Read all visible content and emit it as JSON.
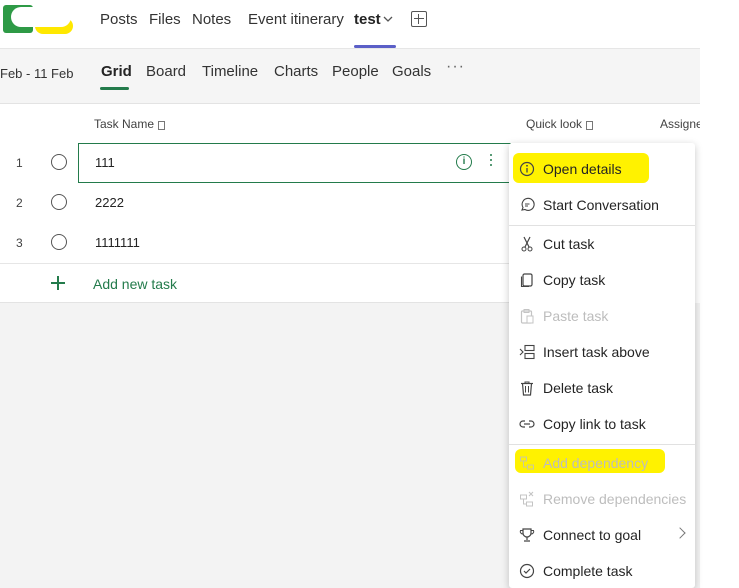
{
  "top_tabs": {
    "items": [
      "Posts",
      "Files",
      "Notes",
      "Event itinerary",
      "test"
    ],
    "active": "test"
  },
  "view": {
    "date_range": "Feb - 11 Feb",
    "tabs": [
      "Grid",
      "Board",
      "Timeline",
      "Charts",
      "People",
      "Goals"
    ],
    "active": "Grid",
    "more": "···"
  },
  "grid": {
    "headers": {
      "task_name": "Task Name",
      "quick_look": "Quick look",
      "assigned": "Assigne"
    },
    "rows": [
      {
        "num": "1",
        "name": "111"
      },
      {
        "num": "2",
        "name": "2222"
      },
      {
        "num": "3",
        "name": "1111111"
      }
    ],
    "add_task": "Add new task"
  },
  "context_menu": {
    "items": [
      {
        "label": "Open details",
        "icon": "info-icon",
        "enabled": true,
        "highlighted": true
      },
      {
        "label": "Start Conversation",
        "icon": "chat-icon",
        "enabled": true
      },
      {
        "label": "Cut task",
        "icon": "scissors-icon",
        "enabled": true
      },
      {
        "label": "Copy task",
        "icon": "copy-icon",
        "enabled": true
      },
      {
        "label": "Paste task",
        "icon": "clipboard-icon",
        "enabled": false
      },
      {
        "label": "Insert task above",
        "icon": "insert-above-icon",
        "enabled": true
      },
      {
        "label": "Delete task",
        "icon": "trash-icon",
        "enabled": true
      },
      {
        "label": "Copy link to task",
        "icon": "link-icon",
        "enabled": true
      },
      {
        "label": "Add dependency",
        "icon": "dependency-icon",
        "enabled": false,
        "highlighted": true
      },
      {
        "label": "Remove dependencies",
        "icon": "remove-dependency-icon",
        "enabled": false
      },
      {
        "label": "Connect to goal",
        "icon": "trophy-icon",
        "enabled": true,
        "submenu": true
      },
      {
        "label": "Complete task",
        "icon": "check-circle-icon",
        "enabled": true
      }
    ]
  },
  "colors": {
    "accent_green": "#237b4b",
    "tab_underline": "#5b5fc7",
    "highlight": "#fff200"
  }
}
